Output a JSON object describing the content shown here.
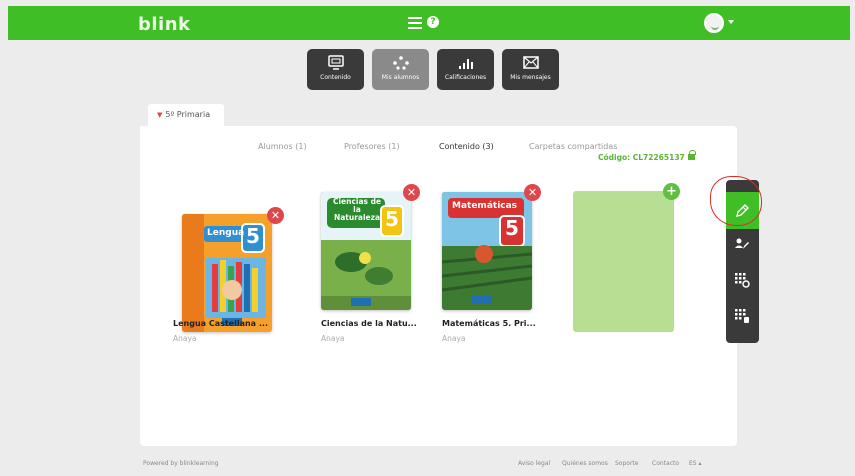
{
  "topbar": {
    "logo": "blink",
    "menu_icon": "hamburger-icon",
    "help_icon": "help-icon",
    "help_label": "?",
    "avatar_icon": "smiley-avatar-icon"
  },
  "nav": [
    {
      "label": "Contenido",
      "icon": "screen-icon",
      "active": false
    },
    {
      "label": "Mis alumnos",
      "icon": "students-icon",
      "active": true
    },
    {
      "label": "Calificaciones",
      "icon": "bar-chart-icon",
      "active": false
    },
    {
      "label": "Mis mensajes",
      "icon": "envelope-icon",
      "active": false
    }
  ],
  "class_tab": {
    "label": "5º Primaria"
  },
  "tabs": {
    "alumnos": "Alumnos (1)",
    "profesores": "Profesores (1)",
    "contenido": "Contenido (3)",
    "carpetas": "Carpetas compartidas"
  },
  "code": {
    "label": "Código: CL72265137"
  },
  "books": [
    {
      "title": "Lengua Castellana ...",
      "publisher": "Anaya",
      "cover_text": "Lengua",
      "cover_number": "5"
    },
    {
      "title": "Ciencias de la Natu...",
      "publisher": "Anaya",
      "cover_text": "Ciencias de la Naturaleza",
      "cover_number": "5"
    },
    {
      "title": "Matemáticas 5. Pri...",
      "publisher": "Anaya",
      "cover_text": "Matemáticas",
      "cover_number": "5"
    }
  ],
  "remove_glyph": "✕",
  "add_glyph": "+",
  "sidebar": [
    {
      "icon": "pencil-icon",
      "active": true
    },
    {
      "icon": "user-edit-icon",
      "active": false
    },
    {
      "icon": "grid-settings-icon",
      "active": false
    },
    {
      "icon": "grid-delete-icon",
      "active": false
    }
  ],
  "footer": {
    "powered": "Powered by blinklearning",
    "links": [
      "Aviso legal",
      "Quiénes somos",
      "Soporte",
      "Contacto"
    ],
    "lang": "ES ▴"
  },
  "colors": {
    "brand": "#3fbf25",
    "danger": "#e0474c",
    "add_card": "#b6df94",
    "dark": "#3a3a3a"
  }
}
